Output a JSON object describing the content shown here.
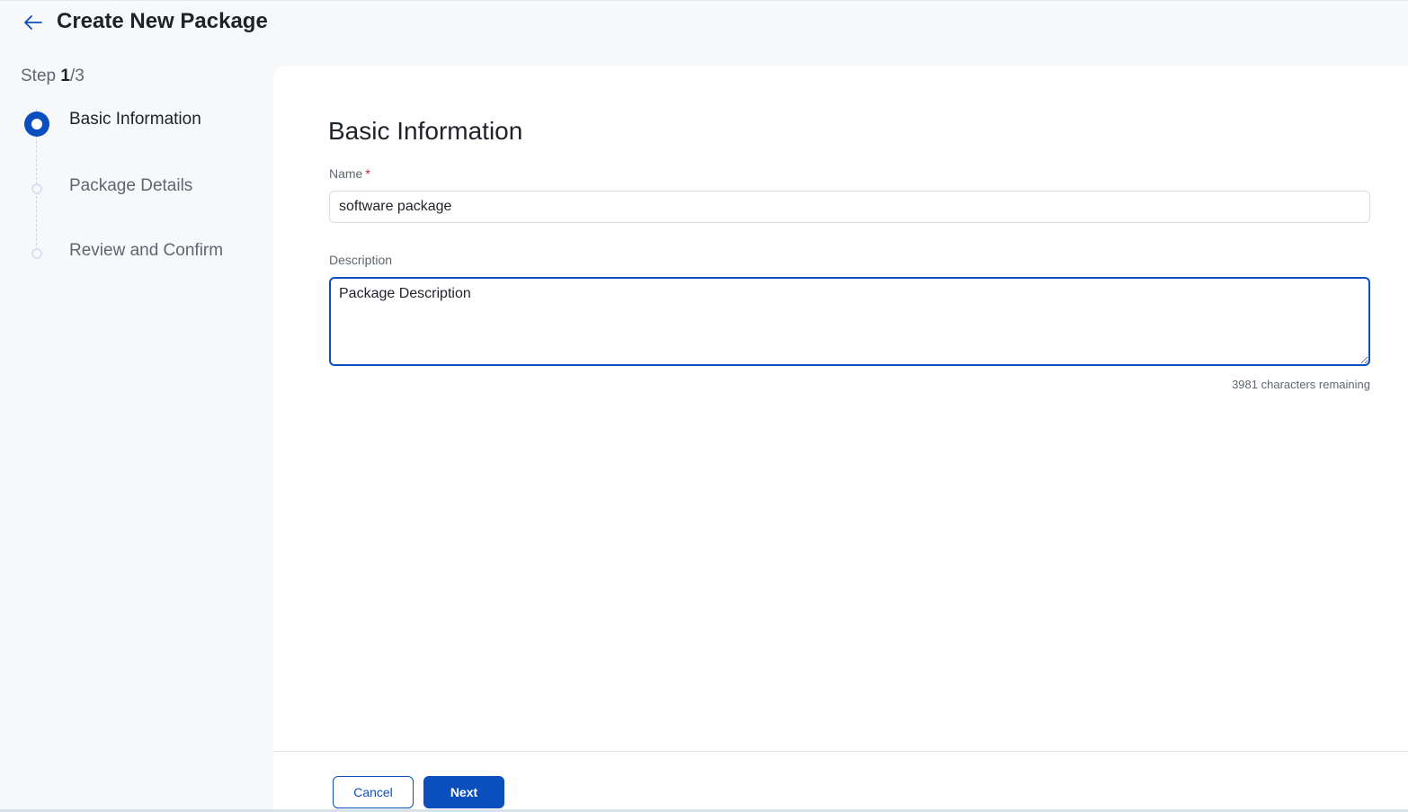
{
  "header": {
    "title": "Create New Package",
    "back_icon": "arrow-left-icon"
  },
  "sidebar": {
    "step_prefix": "Step",
    "current_step": "1",
    "total_steps": "/3",
    "steps": [
      {
        "label": "Basic Information",
        "state": "active"
      },
      {
        "label": "Package Details",
        "state": "inactive"
      },
      {
        "label": "Review and Confirm",
        "state": "inactive"
      }
    ]
  },
  "form": {
    "section_title": "Basic Information",
    "name_label": "Name",
    "name_required_mark": "*",
    "name_value": "software package",
    "description_label": "Description",
    "description_value": "Package Description",
    "chars_remaining": "3981 characters remaining"
  },
  "footer": {
    "cancel_label": "Cancel",
    "next_label": "Next"
  },
  "colors": {
    "accent": "#0b4fbf",
    "required": "#c0232f",
    "background": "#f7f8fa",
    "panel": "#ffffff"
  }
}
